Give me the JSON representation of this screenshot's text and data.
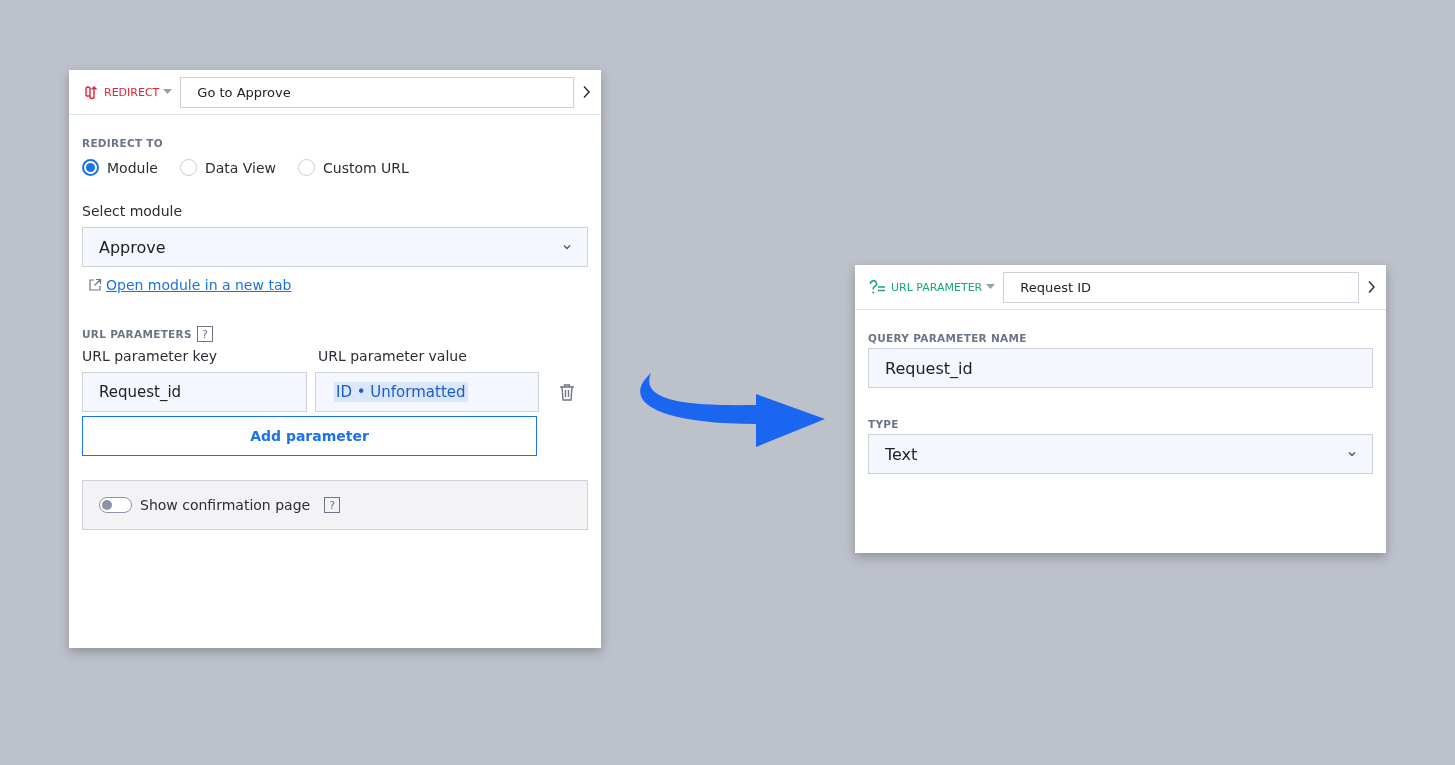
{
  "redirect_panel": {
    "header": {
      "type_label": "REDIRECT",
      "name_value": "Go to Approve"
    },
    "redirect_to": {
      "label": "REDIRECT TO",
      "options": [
        {
          "label": "Module",
          "selected": true
        },
        {
          "label": "Data View",
          "selected": false
        },
        {
          "label": "Custom URL",
          "selected": false
        }
      ]
    },
    "select_module": {
      "label": "Select module",
      "value": "Approve"
    },
    "open_link": "Open module in a new tab",
    "url_parameters": {
      "label": "URL PARAMETERS",
      "help": "?",
      "key_label": "URL parameter key",
      "value_label": "URL parameter value",
      "rows": [
        {
          "key": "Request_id",
          "value": "ID • Unformatted"
        }
      ],
      "add_button": "Add parameter"
    },
    "confirmation": {
      "label": "Show confirmation page",
      "on": false,
      "help": "?"
    }
  },
  "url_parameter_panel": {
    "header": {
      "type_label": "URL PARAMETER",
      "name_value": "Request ID"
    },
    "query_name": {
      "label": "QUERY PARAMETER NAME",
      "value": "Request_id"
    },
    "type": {
      "label": "TYPE",
      "value": "Text"
    }
  }
}
